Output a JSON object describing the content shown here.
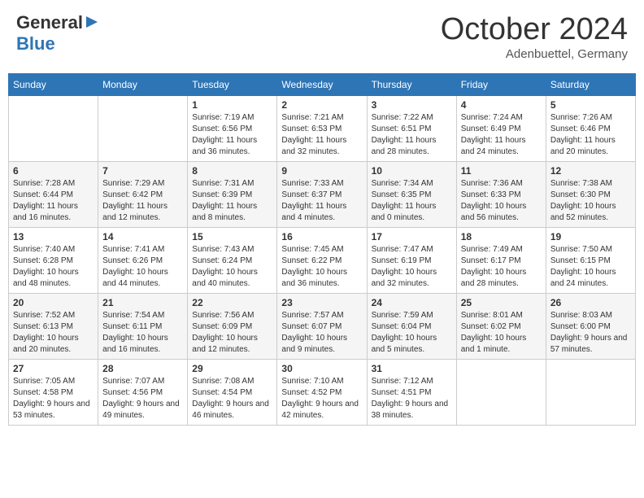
{
  "header": {
    "logo_general": "General",
    "logo_blue": "Blue",
    "month": "October 2024",
    "location": "Adenbuettel, Germany"
  },
  "weekdays": [
    "Sunday",
    "Monday",
    "Tuesday",
    "Wednesday",
    "Thursday",
    "Friday",
    "Saturday"
  ],
  "weeks": [
    [
      {
        "day": "",
        "info": ""
      },
      {
        "day": "",
        "info": ""
      },
      {
        "day": "1",
        "info": "Sunrise: 7:19 AM\nSunset: 6:56 PM\nDaylight: 11 hours and 36 minutes."
      },
      {
        "day": "2",
        "info": "Sunrise: 7:21 AM\nSunset: 6:53 PM\nDaylight: 11 hours and 32 minutes."
      },
      {
        "day": "3",
        "info": "Sunrise: 7:22 AM\nSunset: 6:51 PM\nDaylight: 11 hours and 28 minutes."
      },
      {
        "day": "4",
        "info": "Sunrise: 7:24 AM\nSunset: 6:49 PM\nDaylight: 11 hours and 24 minutes."
      },
      {
        "day": "5",
        "info": "Sunrise: 7:26 AM\nSunset: 6:46 PM\nDaylight: 11 hours and 20 minutes."
      }
    ],
    [
      {
        "day": "6",
        "info": "Sunrise: 7:28 AM\nSunset: 6:44 PM\nDaylight: 11 hours and 16 minutes."
      },
      {
        "day": "7",
        "info": "Sunrise: 7:29 AM\nSunset: 6:42 PM\nDaylight: 11 hours and 12 minutes."
      },
      {
        "day": "8",
        "info": "Sunrise: 7:31 AM\nSunset: 6:39 PM\nDaylight: 11 hours and 8 minutes."
      },
      {
        "day": "9",
        "info": "Sunrise: 7:33 AM\nSunset: 6:37 PM\nDaylight: 11 hours and 4 minutes."
      },
      {
        "day": "10",
        "info": "Sunrise: 7:34 AM\nSunset: 6:35 PM\nDaylight: 11 hours and 0 minutes."
      },
      {
        "day": "11",
        "info": "Sunrise: 7:36 AM\nSunset: 6:33 PM\nDaylight: 10 hours and 56 minutes."
      },
      {
        "day": "12",
        "info": "Sunrise: 7:38 AM\nSunset: 6:30 PM\nDaylight: 10 hours and 52 minutes."
      }
    ],
    [
      {
        "day": "13",
        "info": "Sunrise: 7:40 AM\nSunset: 6:28 PM\nDaylight: 10 hours and 48 minutes."
      },
      {
        "day": "14",
        "info": "Sunrise: 7:41 AM\nSunset: 6:26 PM\nDaylight: 10 hours and 44 minutes."
      },
      {
        "day": "15",
        "info": "Sunrise: 7:43 AM\nSunset: 6:24 PM\nDaylight: 10 hours and 40 minutes."
      },
      {
        "day": "16",
        "info": "Sunrise: 7:45 AM\nSunset: 6:22 PM\nDaylight: 10 hours and 36 minutes."
      },
      {
        "day": "17",
        "info": "Sunrise: 7:47 AM\nSunset: 6:19 PM\nDaylight: 10 hours and 32 minutes."
      },
      {
        "day": "18",
        "info": "Sunrise: 7:49 AM\nSunset: 6:17 PM\nDaylight: 10 hours and 28 minutes."
      },
      {
        "day": "19",
        "info": "Sunrise: 7:50 AM\nSunset: 6:15 PM\nDaylight: 10 hours and 24 minutes."
      }
    ],
    [
      {
        "day": "20",
        "info": "Sunrise: 7:52 AM\nSunset: 6:13 PM\nDaylight: 10 hours and 20 minutes."
      },
      {
        "day": "21",
        "info": "Sunrise: 7:54 AM\nSunset: 6:11 PM\nDaylight: 10 hours and 16 minutes."
      },
      {
        "day": "22",
        "info": "Sunrise: 7:56 AM\nSunset: 6:09 PM\nDaylight: 10 hours and 12 minutes."
      },
      {
        "day": "23",
        "info": "Sunrise: 7:57 AM\nSunset: 6:07 PM\nDaylight: 10 hours and 9 minutes."
      },
      {
        "day": "24",
        "info": "Sunrise: 7:59 AM\nSunset: 6:04 PM\nDaylight: 10 hours and 5 minutes."
      },
      {
        "day": "25",
        "info": "Sunrise: 8:01 AM\nSunset: 6:02 PM\nDaylight: 10 hours and 1 minute."
      },
      {
        "day": "26",
        "info": "Sunrise: 8:03 AM\nSunset: 6:00 PM\nDaylight: 9 hours and 57 minutes."
      }
    ],
    [
      {
        "day": "27",
        "info": "Sunrise: 7:05 AM\nSunset: 4:58 PM\nDaylight: 9 hours and 53 minutes."
      },
      {
        "day": "28",
        "info": "Sunrise: 7:07 AM\nSunset: 4:56 PM\nDaylight: 9 hours and 49 minutes."
      },
      {
        "day": "29",
        "info": "Sunrise: 7:08 AM\nSunset: 4:54 PM\nDaylight: 9 hours and 46 minutes."
      },
      {
        "day": "30",
        "info": "Sunrise: 7:10 AM\nSunset: 4:52 PM\nDaylight: 9 hours and 42 minutes."
      },
      {
        "day": "31",
        "info": "Sunrise: 7:12 AM\nSunset: 4:51 PM\nDaylight: 9 hours and 38 minutes."
      },
      {
        "day": "",
        "info": ""
      },
      {
        "day": "",
        "info": ""
      }
    ]
  ]
}
